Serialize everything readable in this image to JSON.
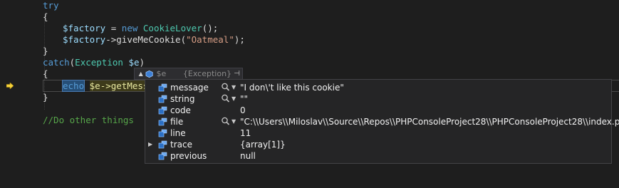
{
  "code": {
    "line1": "try",
    "line2": "{",
    "line3_var": "$factory",
    "line3_op": " = ",
    "line3_kw": "new",
    "line3_type": "CookieLover",
    "line3_end": "();",
    "line4_var": "$factory",
    "line4_method": "->giveMeCookie(",
    "line4_str": "\"Oatmeal\"",
    "line4_end": ");",
    "line5": "}",
    "line6_kw": "catch",
    "line6_open": "(",
    "line6_type": "Exception",
    "line6_var": "$e",
    "line6_close": ")",
    "line7": "{",
    "line8_echo": "echo",
    "line8_stmt": "$e->getMessa",
    "line9": "}",
    "line11_comment": "//Do other things"
  },
  "datatip": {
    "header_name": "$e",
    "header_value": "{Exception}",
    "rows": [
      {
        "name": "message",
        "value": "\"I don\\'t like this cookie\"",
        "has_visualizer": true,
        "expandable": false
      },
      {
        "name": "string",
        "value": "\"\"",
        "has_visualizer": true,
        "expandable": false
      },
      {
        "name": "code",
        "value": "0",
        "has_visualizer": false,
        "expandable": false
      },
      {
        "name": "file",
        "value": "\"C:\\\\Users\\\\Miloslav\\\\Source\\\\Repos\\\\PHPConsoleProject28\\\\PHPConsoleProject28\\\\index.php\"",
        "has_visualizer": true,
        "expandable": false
      },
      {
        "name": "line",
        "value": "11",
        "has_visualizer": false,
        "expandable": false
      },
      {
        "name": "trace",
        "value": "{array[1]}",
        "has_visualizer": false,
        "expandable": true
      },
      {
        "name": "previous",
        "value": "null",
        "has_visualizer": false,
        "expandable": false
      }
    ]
  },
  "colors": {
    "background": "#1e1e1e",
    "keyword": "#569cd6",
    "variable": "#9cdcfe",
    "type": "#4ec9b0",
    "string": "#d69d85",
    "comment": "#57a64a",
    "breakpoint_arrow": "#f5d23a"
  },
  "icons": {
    "current_statement": "arrow-right-icon",
    "field": "field-icon",
    "visualizer": "magnifier-icon"
  }
}
